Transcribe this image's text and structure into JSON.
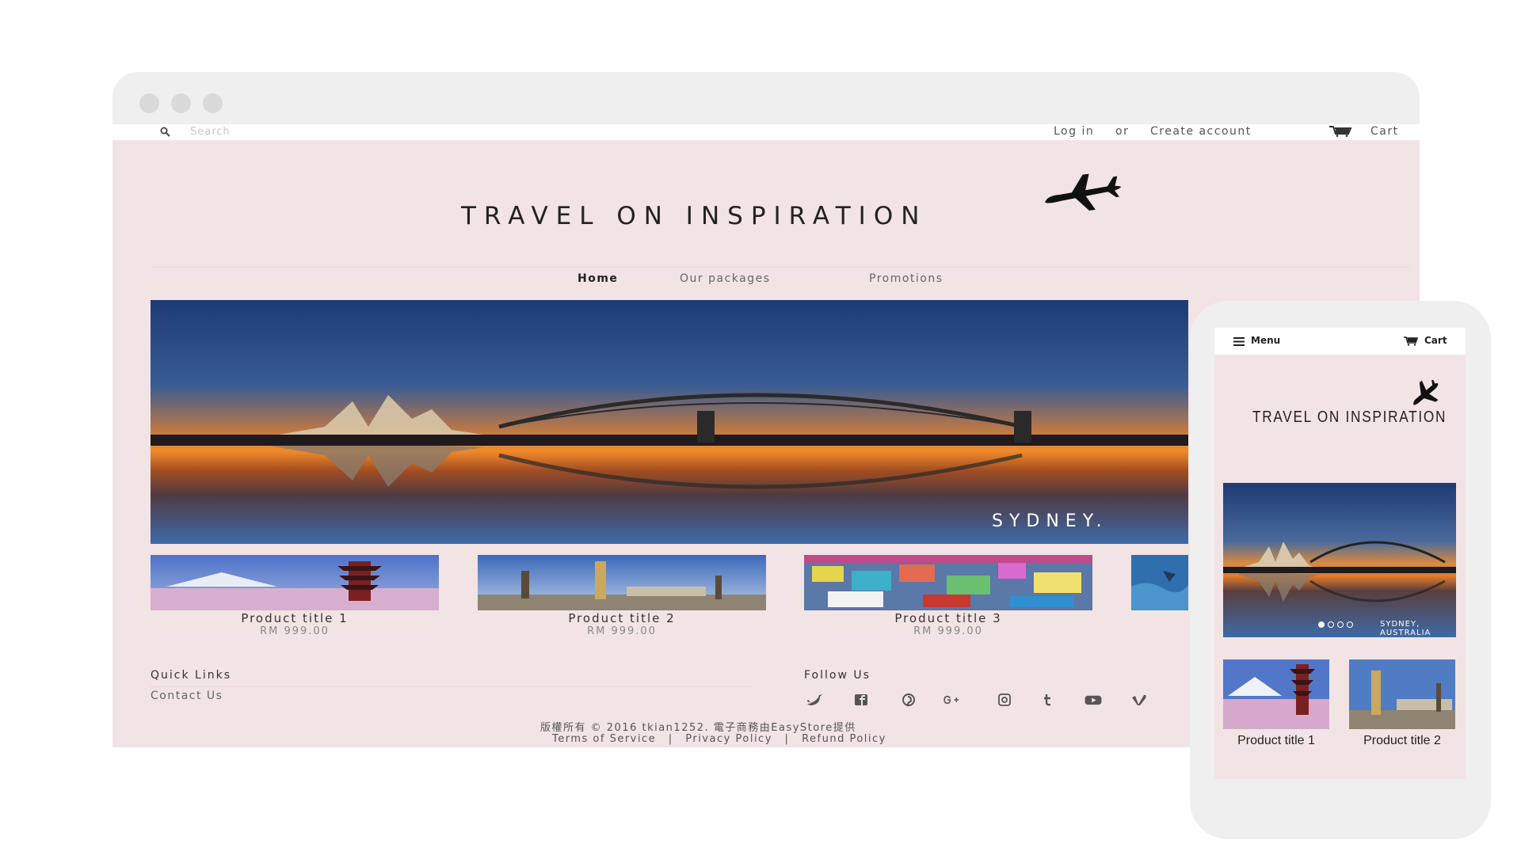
{
  "desktop": {
    "search": {
      "placeholder": "Search",
      "icon": "search-icon"
    },
    "account": {
      "login": "Log in",
      "or": "or",
      "create": "Create account"
    },
    "cart": {
      "label": "Cart",
      "icon": "cart-icon"
    },
    "logo": {
      "text": "TRAVEL ON INSPIRATION",
      "icon": "airplane-icon"
    },
    "nav": [
      {
        "label": "Home",
        "active": true
      },
      {
        "label": "Our packages",
        "active": false
      },
      {
        "label": "Promotions",
        "active": false
      }
    ],
    "hero": {
      "caption": "SYDNEY."
    },
    "products": [
      {
        "title": "Product title 1",
        "price": "RM 999.00"
      },
      {
        "title": "Product title 2",
        "price": "RM 999.00"
      },
      {
        "title": "Product title 3",
        "price": "RM 999.00"
      }
    ],
    "footer": {
      "quick_links_title": "Quick Links",
      "quick_links": [
        "Contact Us"
      ],
      "follow_title": "Follow Us",
      "social_icons": [
        "twitter-icon",
        "facebook-icon",
        "pinterest-icon",
        "google-plus-icon",
        "instagram-icon",
        "tumblr-icon",
        "youtube-icon",
        "vimeo-icon"
      ],
      "copyright": "版權所有 © 2016 tkian1252. 電子商務由EasyStore提供",
      "policies": [
        "Terms of Service",
        "Privacy Policy",
        "Refund Policy"
      ],
      "separator": "|"
    }
  },
  "mobile": {
    "menu_label": "Menu",
    "cart_label": "Cart",
    "logo": "TRAVEL ON INSPIRATION",
    "hero": {
      "caption": "SYDNEY, AUSTRALIA",
      "slides": 4,
      "active_slide": 1
    },
    "products": [
      {
        "title": "Product title 1"
      },
      {
        "title": "Product title 2"
      }
    ]
  },
  "colors": {
    "site_background": "#f2e4e4",
    "browser_chrome": "#efefef",
    "browser_dots": "#dadada",
    "text_dark": "#222222",
    "sky_top": "#1f3f78",
    "sunset_orange": "#f08a2a"
  }
}
